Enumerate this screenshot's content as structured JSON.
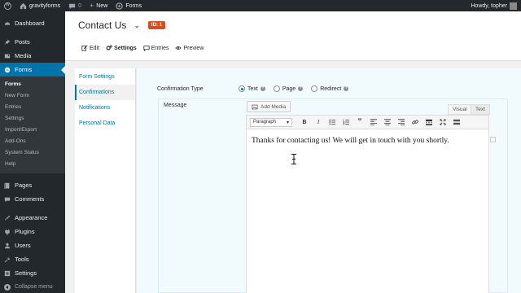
{
  "admin_bar": {
    "site_name": "gravityforms",
    "comments_count": "0",
    "new_label": "New",
    "forms_label": "Forms",
    "greeting": "Howdy, topher"
  },
  "sidebar": {
    "items_top": [
      {
        "label": "Dashboard",
        "icon": "dashboard-icon"
      }
    ],
    "items_posts": [
      {
        "label": "Posts",
        "icon": "pin-icon"
      },
      {
        "label": "Media",
        "icon": "media-icon"
      }
    ],
    "current_label": "Forms",
    "submenu": [
      "Forms",
      "New Form",
      "Entries",
      "Settings",
      "Import/Export",
      "Add-Ons",
      "System Status",
      "Help"
    ],
    "items_pages": [
      {
        "label": "Pages",
        "icon": "pages-icon"
      },
      {
        "label": "Comments",
        "icon": "comments-icon"
      }
    ],
    "items_bottom": [
      {
        "label": "Appearance",
        "icon": "brush-icon"
      },
      {
        "label": "Plugins",
        "icon": "plugin-icon"
      },
      {
        "label": "Users",
        "icon": "users-icon"
      },
      {
        "label": "Tools",
        "icon": "wrench-icon"
      },
      {
        "label": "Settings",
        "icon": "settings-icon"
      }
    ],
    "collapse_label": "Collapse menu"
  },
  "header": {
    "form_title": "Contact Us",
    "id_badge": "ID: 1",
    "toolbar": {
      "edit": "Edit",
      "settings": "Settings",
      "entries": "Entries",
      "preview": "Preview"
    }
  },
  "settings_nav": {
    "items": [
      "Form Settings",
      "Confirmations",
      "Notifications",
      "Personal Data"
    ],
    "current_index": 1
  },
  "confirmation": {
    "type_label": "Confirmation Type",
    "options": [
      "Text",
      "Page",
      "Redirect"
    ],
    "selected": "Text",
    "message_label": "Message",
    "add_media": "Add Media",
    "visual_tab": "Visual",
    "text_tab": "Text",
    "format_select": "Paragraph",
    "message_text": "Thanks for contacting us! We will get in touch with you shortly."
  },
  "colors": {
    "admin_dark": "#23282d",
    "accent_blue": "#0073aa",
    "badge_orange": "#d54e21",
    "panel_bg": "#f1fbfd"
  }
}
